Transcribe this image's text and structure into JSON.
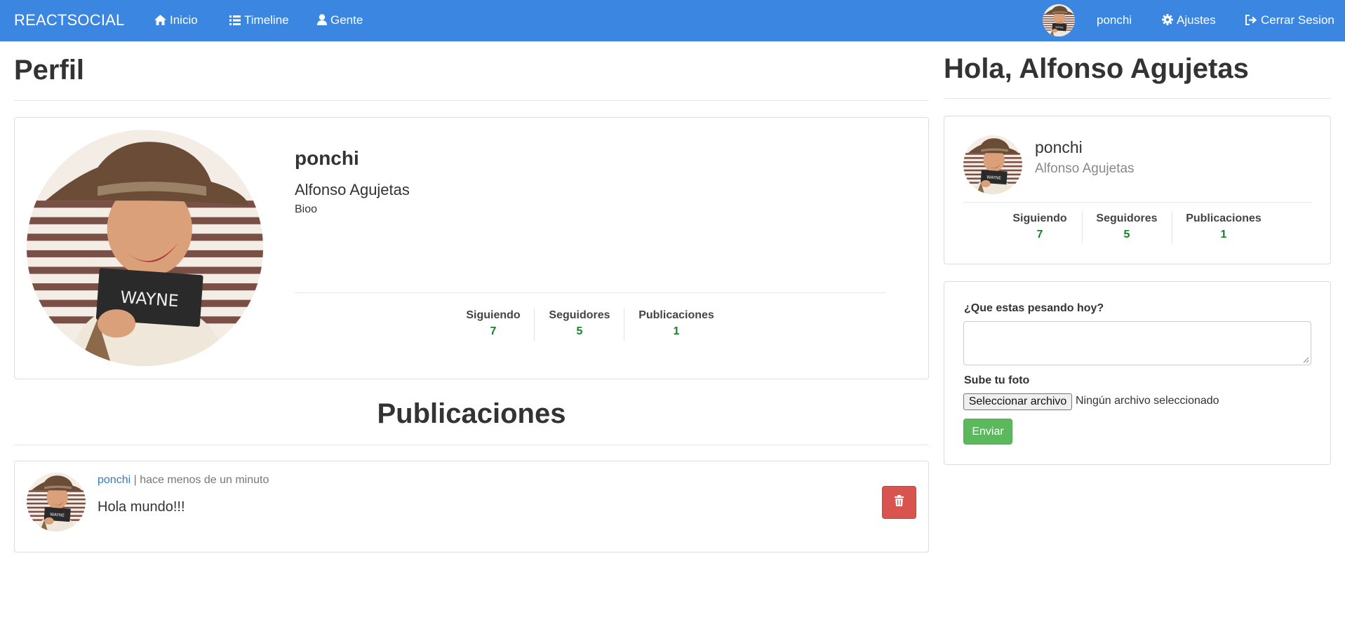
{
  "navbar": {
    "brand": "REACTSOCIAL",
    "links": [
      {
        "label": "Inicio",
        "icon": "home-icon"
      },
      {
        "label": "Timeline",
        "icon": "list-icon"
      },
      {
        "label": "Gente",
        "icon": "user-icon"
      }
    ],
    "username": "ponchi",
    "settings_label": "Ajustes",
    "logout_label": "Cerrar Sesion",
    "color": "#3a86e0"
  },
  "profile": {
    "page_title": "Perfil",
    "username": "ponchi",
    "full_name": "Alfonso Agujetas",
    "bio": "Bioo",
    "stats": [
      {
        "label": "Siguiendo",
        "value": "7"
      },
      {
        "label": "Seguidores",
        "value": "5"
      },
      {
        "label": "Publicaciones",
        "value": "1"
      }
    ]
  },
  "posts_section": {
    "title": "Publicaciones",
    "posts": [
      {
        "user": "ponchi",
        "time": "hace menos de un minuto",
        "text": "Hola mundo!!!"
      }
    ]
  },
  "sidebar": {
    "greeting": "Hola, Alfonso Agujetas",
    "username": "ponchi",
    "full_name": "Alfonso Agujetas",
    "stats": [
      {
        "label": "Siguiendo",
        "value": "7"
      },
      {
        "label": "Seguidores",
        "value": "5"
      },
      {
        "label": "Publicaciones",
        "value": "1"
      }
    ],
    "form": {
      "text_label": "¿Que estas pesando hoy?",
      "photo_label": "Sube tu foto",
      "file_button": "Seleccionar archivo",
      "file_status": "Ningún archivo seleccionado",
      "submit_label": "Enviar"
    }
  },
  "colors": {
    "stat_number": "#18802a",
    "link": "#337ab7",
    "danger": "#d9534f",
    "success": "#5cb85c"
  }
}
